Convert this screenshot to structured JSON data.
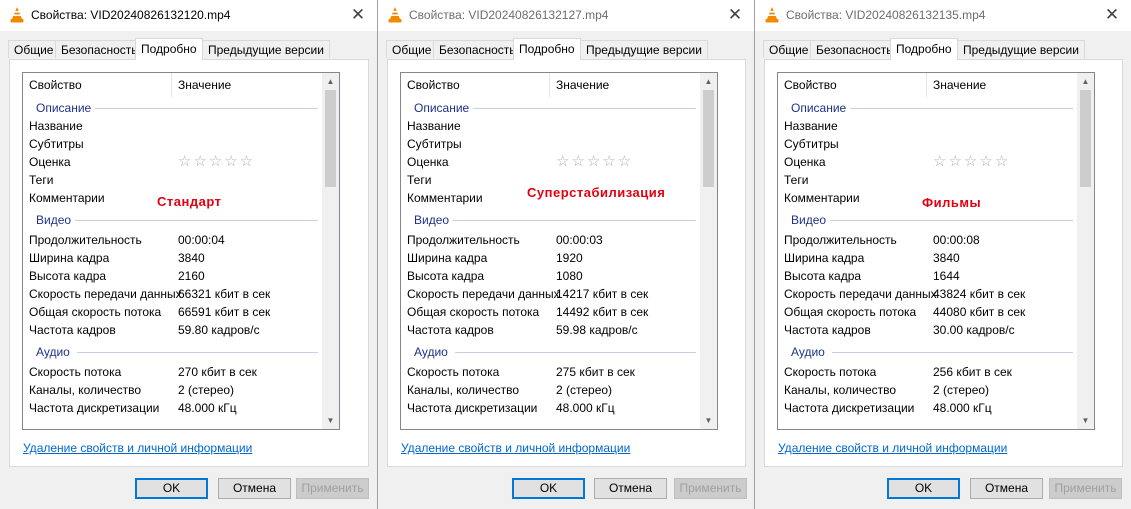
{
  "dialogs": [
    {
      "title": "Свойства: VID20240826132120.mp4",
      "tabs": [
        "Общие",
        "Безопасность",
        "Подробно",
        "Предыдущие версии"
      ],
      "active_tab": 2,
      "headers": {
        "property": "Свойство",
        "value": "Значение"
      },
      "groups": {
        "description": "Описание",
        "video": "Видео",
        "audio": "Аудио"
      },
      "description": [
        {
          "k": "Название",
          "v": ""
        },
        {
          "k": "Субтитры",
          "v": ""
        },
        {
          "k": "Оценка",
          "v": ""
        },
        {
          "k": "Теги",
          "v": ""
        },
        {
          "k": "Комментарии",
          "v": ""
        }
      ],
      "rating_stars": "☆☆☆☆☆",
      "rating_value": 0,
      "video": [
        {
          "k": "Продолжительность",
          "v": "00:00:04"
        },
        {
          "k": "Ширина кадра",
          "v": "3840"
        },
        {
          "k": "Высота кадра",
          "v": "2160"
        },
        {
          "k": "Скорость передачи данных",
          "v": "66321 кбит в сек"
        },
        {
          "k": "Общая скорость потока",
          "v": "66591 кбит в сек"
        },
        {
          "k": "Частота кадров",
          "v": "59.80 кадров/с"
        }
      ],
      "audio": [
        {
          "k": "Скорость потока",
          "v": "270 кбит в сек"
        },
        {
          "k": "Каналы, количество",
          "v": "2 (стерео)"
        },
        {
          "k": "Частота дискретизации",
          "v": "48.000 кГц"
        }
      ],
      "annotation": "Стандарт",
      "link": "Удаление свойств и личной информации",
      "buttons": {
        "ok": "OK",
        "cancel": "Отмена",
        "apply": "Применить"
      }
    },
    {
      "title": "Свойства: VID20240826132127.mp4",
      "tabs": [
        "Общие",
        "Безопасность",
        "Подробно",
        "Предыдущие версии"
      ],
      "active_tab": 2,
      "headers": {
        "property": "Свойство",
        "value": "Значение"
      },
      "groups": {
        "description": "Описание",
        "video": "Видео",
        "audio": "Аудио"
      },
      "description": [
        {
          "k": "Название",
          "v": ""
        },
        {
          "k": "Субтитры",
          "v": ""
        },
        {
          "k": "Оценка",
          "v": ""
        },
        {
          "k": "Теги",
          "v": ""
        },
        {
          "k": "Комментарии",
          "v": ""
        }
      ],
      "rating_stars": "☆☆☆☆☆",
      "rating_value": 0,
      "video": [
        {
          "k": "Продолжительность",
          "v": "00:00:03"
        },
        {
          "k": "Ширина кадра",
          "v": "1920"
        },
        {
          "k": "Высота кадра",
          "v": "1080"
        },
        {
          "k": "Скорость передачи данных",
          "v": "14217 кбит в сек"
        },
        {
          "k": "Общая скорость потока",
          "v": "14492 кбит в сек"
        },
        {
          "k": "Частота кадров",
          "v": "59.98 кадров/с"
        }
      ],
      "audio": [
        {
          "k": "Скорость потока",
          "v": "275 кбит в сек"
        },
        {
          "k": "Каналы, количество",
          "v": "2 (стерео)"
        },
        {
          "k": "Частота дискретизации",
          "v": "48.000 кГц"
        }
      ],
      "annotation": "Суперстабилизация",
      "link": "Удаление свойств и личной информации",
      "buttons": {
        "ok": "OK",
        "cancel": "Отмена",
        "apply": "Применить"
      }
    },
    {
      "title": "Свойства: VID20240826132135.mp4",
      "tabs": [
        "Общие",
        "Безопасность",
        "Подробно",
        "Предыдущие версии"
      ],
      "active_tab": 2,
      "headers": {
        "property": "Свойство",
        "value": "Значение"
      },
      "groups": {
        "description": "Описание",
        "video": "Видео",
        "audio": "Аудио"
      },
      "description": [
        {
          "k": "Название",
          "v": ""
        },
        {
          "k": "Субтитры",
          "v": ""
        },
        {
          "k": "Оценка",
          "v": ""
        },
        {
          "k": "Теги",
          "v": ""
        },
        {
          "k": "Комментарии",
          "v": ""
        }
      ],
      "rating_stars": "☆☆☆☆☆",
      "rating_value": 0,
      "video": [
        {
          "k": "Продолжительность",
          "v": "00:00:08"
        },
        {
          "k": "Ширина кадра",
          "v": "3840"
        },
        {
          "k": "Высота кадра",
          "v": "1644"
        },
        {
          "k": "Скорость передачи данных",
          "v": "43824 кбит в сек"
        },
        {
          "k": "Общая скорость потока",
          "v": "44080 кбит в сек"
        },
        {
          "k": "Частота кадров",
          "v": "30.00 кадров/с"
        }
      ],
      "audio": [
        {
          "k": "Скорость потока",
          "v": "256 кбит в сек"
        },
        {
          "k": "Каналы, количество",
          "v": "2 (стерео)"
        },
        {
          "k": "Частота дискретизации",
          "v": "48.000 кГц"
        }
      ],
      "annotation": "Фильмы",
      "link": "Удаление свойств и личной информации",
      "buttons": {
        "ok": "OK",
        "cancel": "Отмена",
        "apply": "Применить"
      }
    }
  ],
  "icons": {
    "app": "vlc-cone-icon",
    "close": "close-icon",
    "scroll_up": "scroll-up-arrow-icon",
    "scroll_down": "scroll-down-arrow-icon"
  },
  "colors": {
    "group_heading": "#1e3287",
    "annotation": "#e3000f",
    "link": "#0066cc",
    "ok_border": "#0078d7"
  }
}
